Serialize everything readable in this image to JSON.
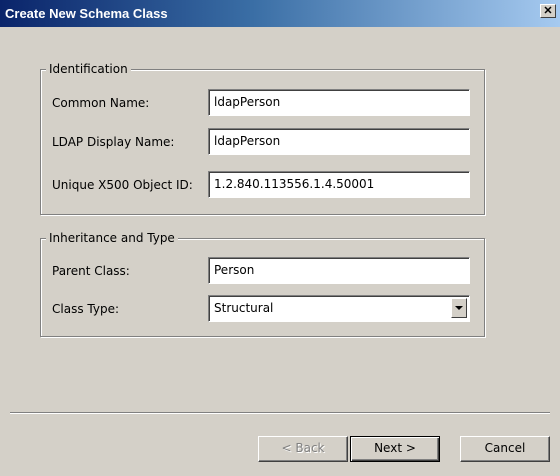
{
  "window": {
    "title": "Create New Schema Class",
    "close_glyph": "✕"
  },
  "identification": {
    "legend": "Identification",
    "common_name_label": "Common Name:",
    "common_name_value": "ldapPerson",
    "ldap_display_name_label": "LDAP Display Name:",
    "ldap_display_name_value": "ldapPerson",
    "oid_label": "Unique X500 Object ID:",
    "oid_value": "1.2.840.113556.1.4.50001"
  },
  "inheritance": {
    "legend": "Inheritance and Type",
    "parent_class_label": "Parent Class:",
    "parent_class_value": "Person",
    "class_type_label": "Class Type:",
    "class_type_value": "Structural"
  },
  "buttons": {
    "back_label": "< Back",
    "next_label": "Next >",
    "cancel_label": "Cancel"
  },
  "icons": {
    "close": "close-icon",
    "dropdown": "chevron-down-icon"
  },
  "colors": {
    "dialog_face": "#d4d0c8",
    "titlebar_start": "#0a246a",
    "titlebar_end": "#a6caf0"
  }
}
